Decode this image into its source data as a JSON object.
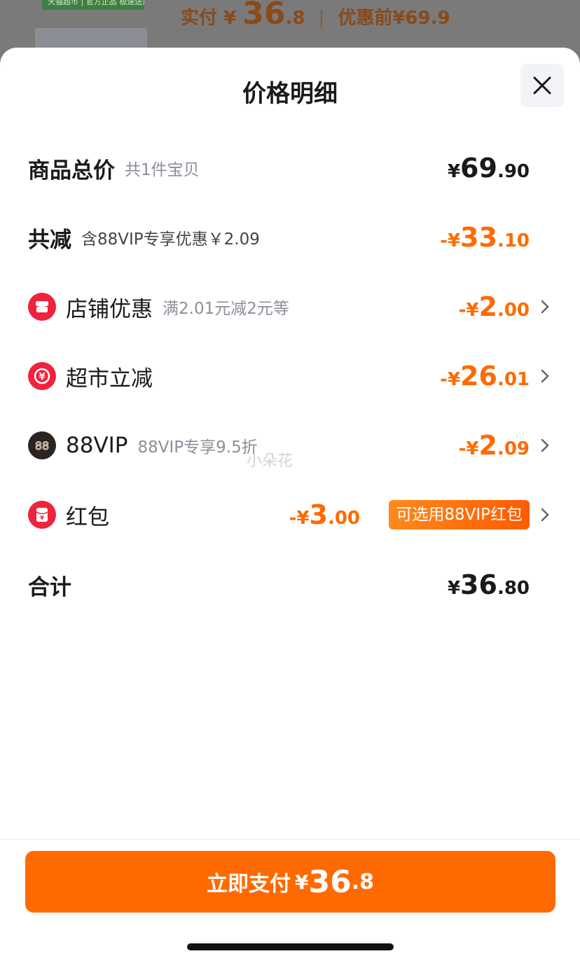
{
  "background": {
    "badge_text": "天猫超市 | 官方正品 极速送达",
    "paid_label": "实付",
    "paid_currency": "¥",
    "paid_int": "36",
    "paid_dec": ".8",
    "separator": "|",
    "original_price": "优惠前¥69.9"
  },
  "sheet": {
    "title": "价格明细",
    "close_icon": "close-icon"
  },
  "rows": {
    "total": {
      "label": "商品总价",
      "sub": "共1件宝贝",
      "currency": "¥",
      "int": "69",
      "dec": ".90"
    },
    "discount": {
      "label": "共减",
      "sub": "含88VIP专享优惠￥2.09",
      "prefix": "-¥",
      "int": "33",
      "dec": ".10"
    },
    "store": {
      "label": "店铺优惠",
      "sub": "满2.01元减2元等",
      "prefix": "-¥",
      "int": "2",
      "dec": ".00",
      "icon": "store-icon"
    },
    "market": {
      "label": "超市立减",
      "prefix": "-¥",
      "int": "26",
      "dec": ".01",
      "icon": "yuan-coin-icon"
    },
    "vip": {
      "label": "88VIP",
      "sub": "88VIP专享9.5折",
      "prefix": "-¥",
      "int": "2",
      "dec": ".09",
      "icon": "vip-88-icon"
    },
    "redpacket": {
      "label": "红包",
      "prefix": "-¥",
      "int": "3",
      "dec": ".00",
      "tag": "可选用88VIP红包",
      "icon": "red-packet-icon"
    },
    "sum": {
      "label": "合计",
      "currency": "¥",
      "int": "36",
      "dec": ".80"
    }
  },
  "watermark": "小朵花",
  "pay_button": {
    "label": "立即支付",
    "currency": "¥",
    "int": "36",
    "dec": ".8"
  },
  "colors": {
    "accent": "#ff6a00",
    "red_icon": "#f0233c",
    "vip_icon": "#2b2420"
  }
}
